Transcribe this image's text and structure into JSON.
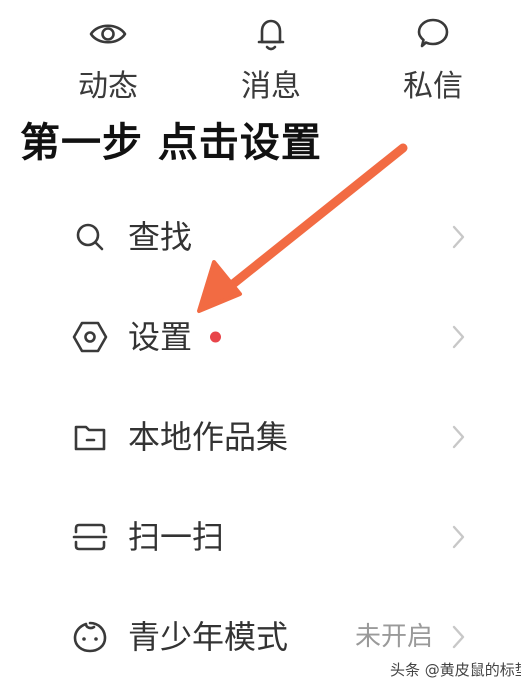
{
  "tabs": [
    {
      "label": "动态",
      "icon": "eye-icon"
    },
    {
      "label": "消息",
      "icon": "bell-icon"
    },
    {
      "label": "私信",
      "icon": "chat-bubble-icon"
    }
  ],
  "instruction": "第一步 点击设置",
  "menu": [
    {
      "label": "查找",
      "icon": "search-icon"
    },
    {
      "label": "设置",
      "icon": "hexagon-settings-icon",
      "badge": "red-dot"
    },
    {
      "label": "本地作品集",
      "icon": "folder-icon"
    },
    {
      "label": "扫一扫",
      "icon": "scan-icon"
    },
    {
      "label": "青少年模式",
      "icon": "child-face-icon",
      "status": "未开启"
    }
  ],
  "watermark": "头条 @黄皮鼠的标垫",
  "colors": {
    "arrow": "#f26b43",
    "badge": "#e8454a",
    "text": "#333333",
    "chevron": "#c8c8c8",
    "status": "#9a9a9a"
  }
}
